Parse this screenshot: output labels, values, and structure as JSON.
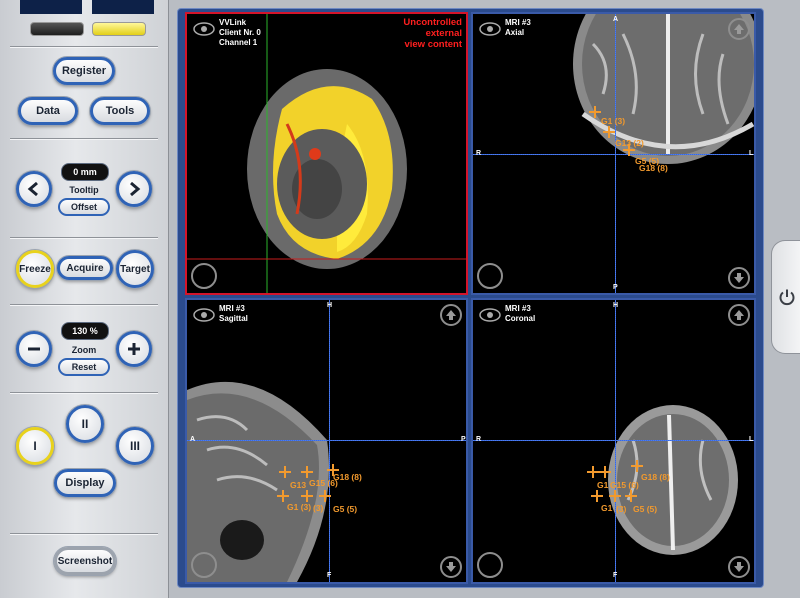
{
  "controls": {
    "register": "Register",
    "data": "Data",
    "tools": "Tools",
    "tooltip_value": "0 mm",
    "tooltip_caption": "Tooltip",
    "offset": "Offset",
    "freeze": "Freeze",
    "acquire": "Acquire",
    "target": "Target",
    "zoom_value": "130 %",
    "zoom_caption": "Zoom",
    "reset": "Reset",
    "layout_1": "I",
    "layout_2": "II",
    "layout_3": "III",
    "display": "Display",
    "screenshot": "Screenshot"
  },
  "views": {
    "vvlink": {
      "line1": "VVLink",
      "line2": "Client Nr. 0",
      "line3": "Channel 1",
      "warning1": "Uncontrolled",
      "warning2": "external",
      "warning3": "view content"
    },
    "axial": {
      "line1": "MRI #3",
      "line2": "Axial",
      "top": "A",
      "left": "R",
      "right": "L",
      "bottom": "P"
    },
    "sagittal": {
      "line1": "MRI #3",
      "line2": "Sagittal",
      "top": "H",
      "left": "A",
      "right": "P",
      "bottom": "F"
    },
    "coronal": {
      "line1": "MRI #3",
      "line2": "Coronal",
      "top": "H",
      "left": "R",
      "right": "L",
      "bottom": "F"
    }
  },
  "markers": {
    "axial": [
      "G1 (3)",
      "G13 (2)",
      "G5 (5)",
      "G18 (8)",
      "G"
    ],
    "sagittal": [
      "G18 (8)",
      "G13",
      "G15 (6)",
      "G1 (3)",
      "(3)",
      "G5 (5)"
    ],
    "coronal": [
      "G18 (8)",
      "G1",
      "G15 (6)",
      "G1",
      "(3)",
      "G5 (5)"
    ]
  },
  "colors": {
    "accent_blue": "#2f63b6",
    "freeze_active": "#e8d21c",
    "warning_red": "#ff1f1f",
    "marker_orange": "#f29a2e"
  },
  "icons": [
    "eye-icon",
    "arrow-left-icon",
    "arrow-right-icon",
    "minus-icon",
    "plus-icon",
    "arrow-up-icon",
    "arrow-down-icon",
    "zoom-icon",
    "power-icon"
  ]
}
